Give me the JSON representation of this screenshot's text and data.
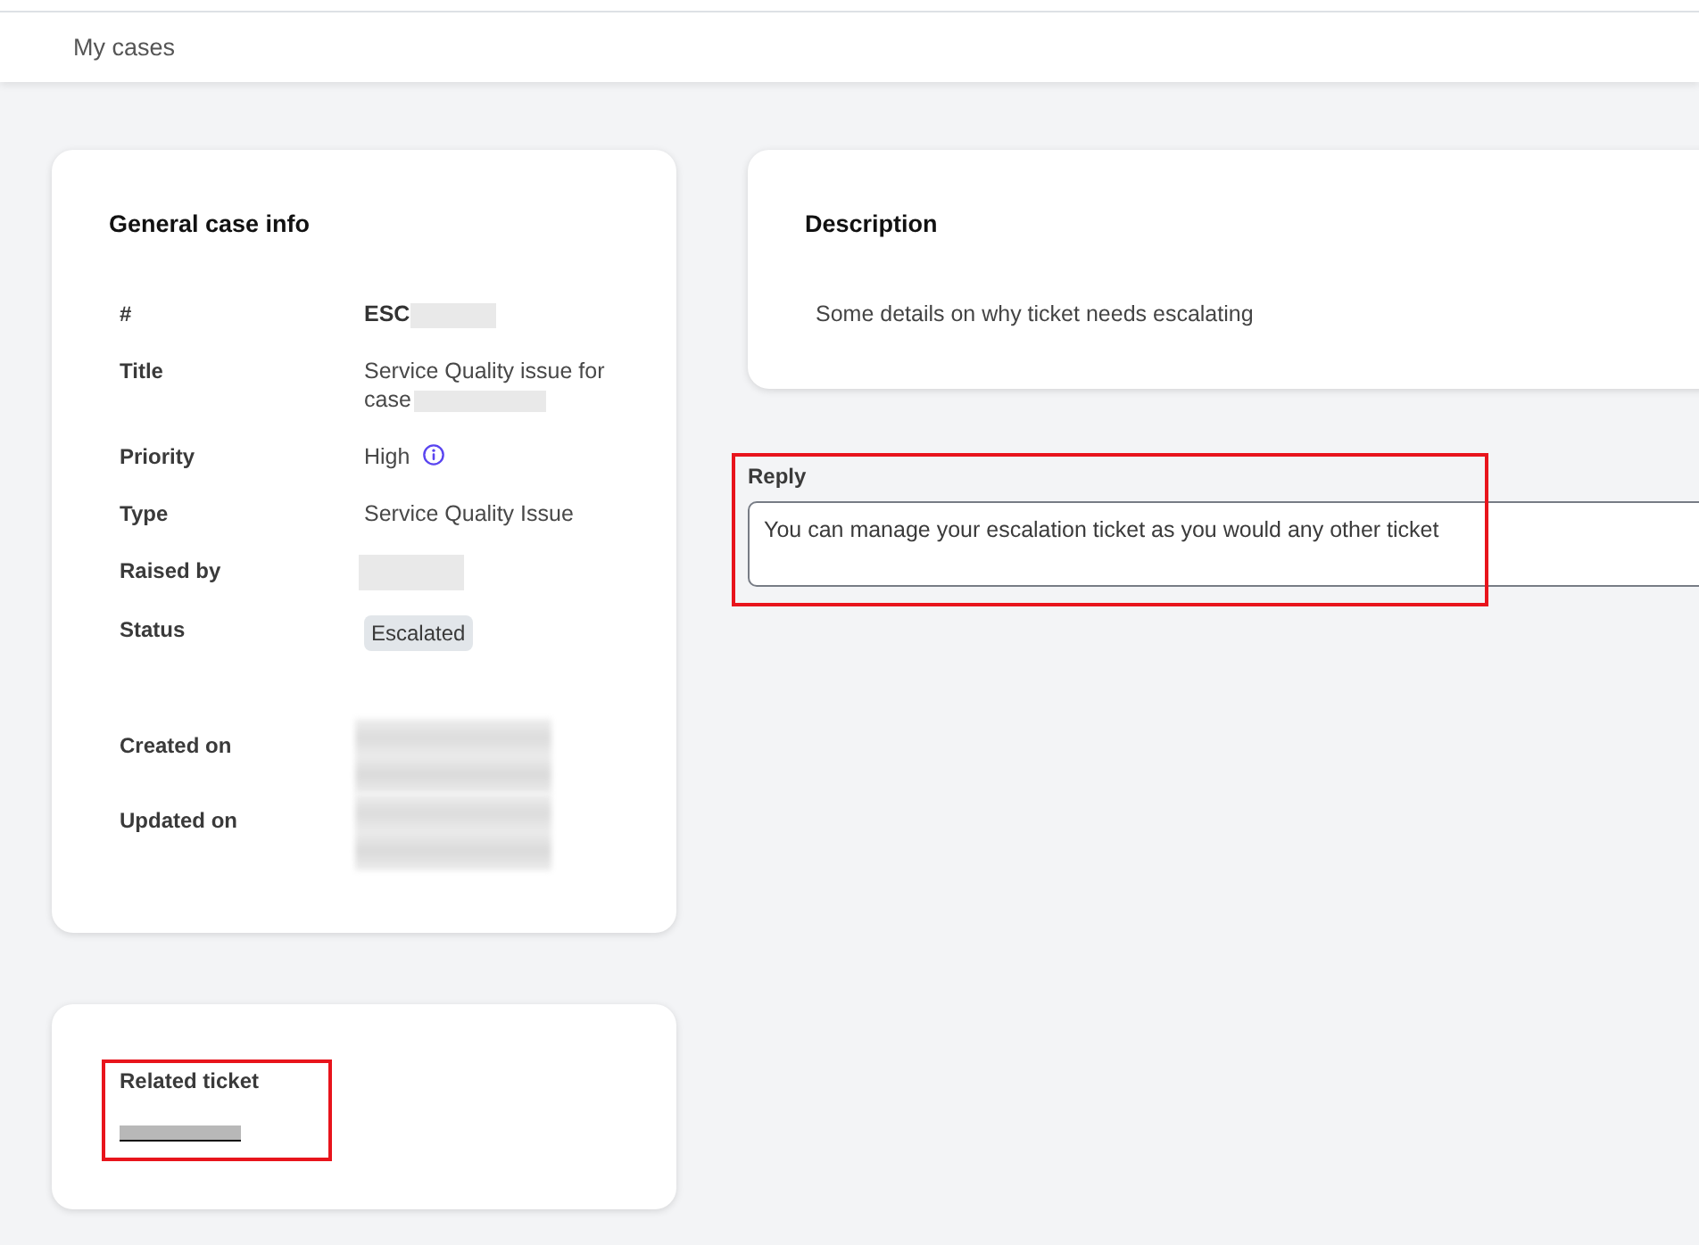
{
  "header": {
    "title": "My cases"
  },
  "case_info": {
    "title": "General case info",
    "rows": [
      {
        "label": "#",
        "value": "ESC",
        "kind": "id",
        "redacted": true,
        "info": false
      },
      {
        "label": "Title",
        "value": "Service Quality issue for case",
        "kind": "text",
        "redacted": true,
        "info": false
      },
      {
        "label": "Priority",
        "value": "High",
        "kind": "text",
        "redacted": false,
        "info": true
      },
      {
        "label": "Type",
        "value": "Service Quality Issue",
        "kind": "text",
        "redacted": false,
        "info": false
      },
      {
        "label": "Raised by",
        "kind": "text",
        "redacted": true,
        "info": false
      },
      {
        "label": "Status",
        "value": "Escalated",
        "kind": "badge",
        "redacted": false,
        "info": false
      },
      {
        "label": "Created on",
        "kind": "date",
        "redacted": true,
        "info": false
      },
      {
        "label": "Updated on",
        "kind": "date",
        "redacted": true,
        "info": false
      }
    ]
  },
  "related_ticket": {
    "label": "Related ticket",
    "link_redacted": true,
    "highlighted": true
  },
  "description": {
    "title": "Description",
    "text": "Some details on why ticket needs escalating"
  },
  "reply": {
    "label": "Reply",
    "value": "You can manage your escalation ticket as you would any other ticket",
    "highlighted": true
  }
}
